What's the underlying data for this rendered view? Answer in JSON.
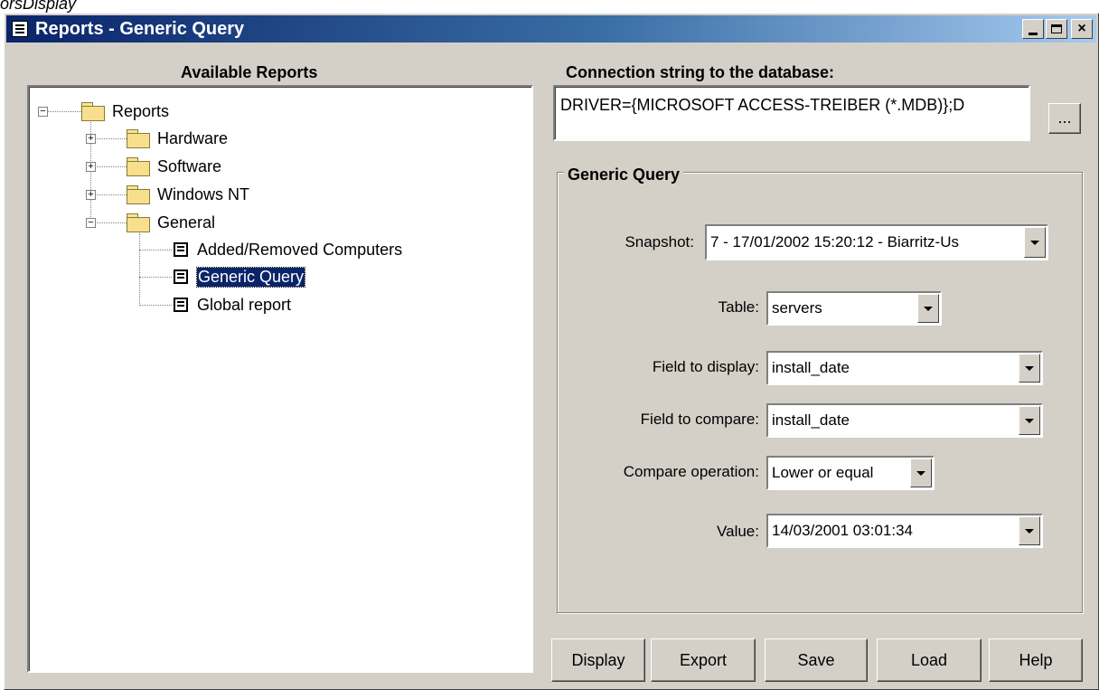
{
  "page_caption": "orsDisplay",
  "window": {
    "title": "Reports - Generic Query",
    "controls": {
      "minimize": "_",
      "maximize": "□",
      "close": "×"
    }
  },
  "available_reports": {
    "heading": "Available Reports",
    "root": {
      "label": "Reports",
      "expanded": true
    },
    "folders": [
      {
        "label": "Hardware",
        "expanded": false
      },
      {
        "label": "Software",
        "expanded": false
      },
      {
        "label": "Windows NT",
        "expanded": false
      },
      {
        "label": "General",
        "expanded": true
      }
    ],
    "general_items": [
      {
        "label": "Added/Removed Computers",
        "selected": false
      },
      {
        "label": "Generic Query",
        "selected": true
      },
      {
        "label": "Global report",
        "selected": false
      }
    ]
  },
  "connection": {
    "label": "Connection string to the database:",
    "value": "DRIVER={MICROSOFT ACCESS-TREIBER (*.MDB)};D",
    "browse_label": "..."
  },
  "generic_query": {
    "title": "Generic Query",
    "snapshot": {
      "label": "Snapshot:",
      "value": "7 - 17/01/2002 15:20:12 - Biarritz-Us"
    },
    "table": {
      "label": "Table:",
      "value": "servers"
    },
    "field_display": {
      "label": "Field to display:",
      "value": "install_date"
    },
    "field_compare": {
      "label": "Field to compare:",
      "value": "install_date"
    },
    "compare_operation": {
      "label": "Compare operation:",
      "value": "Lower or equal"
    },
    "value": {
      "label": "Value:",
      "value": "14/03/2001 03:01:34"
    }
  },
  "buttons": {
    "display": "Display",
    "export": "Export",
    "save": "Save",
    "load": "Load",
    "help": "Help"
  },
  "colors": {
    "dialog": "#d4d0c8",
    "titlebar_start": "#0a246a",
    "titlebar_end": "#a6caf0",
    "selection": "#0a246a"
  }
}
